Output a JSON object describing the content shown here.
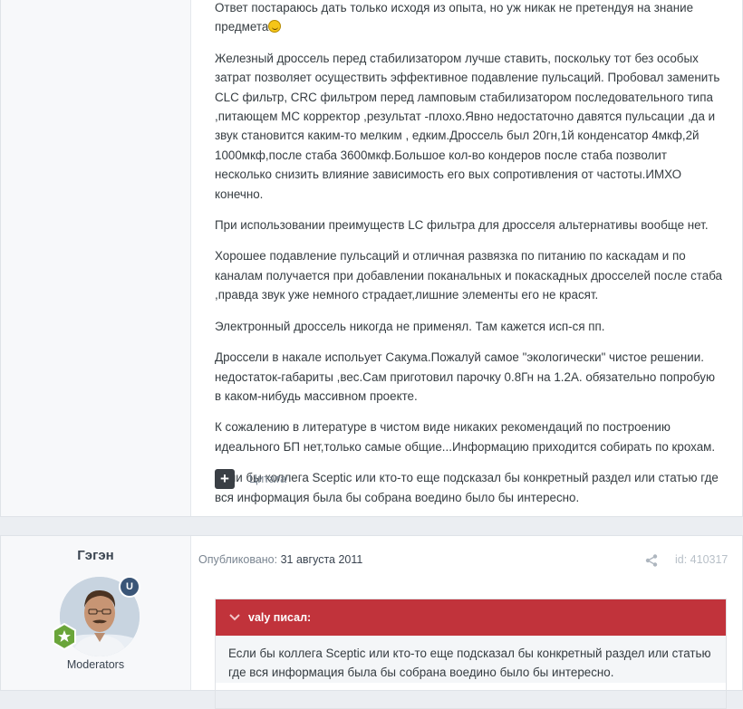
{
  "post1": {
    "paragraphs": [
      "Ответ постараюсь дать только исходя из опыта, но уж никак не претендуя на знание предмета",
      "Железный дроссель перед стабилизатором лучше ставить, поскольку тот без особых затрат позволяет осуществить эффективное подавление пульсаций. Пробовал заменить CLC фильтр, CRC фильтром перед ламповым стабилизатором последовательного типа ,питающем МС корректор ,результат -плохо.Явно недостаточно давятся пульсации ,да и звук становится каким-то мелким , едким.Дроссель был 20гн,1й конденсатор 4мкф,2й 1000мкф,после стаба 3600мкф.Большое кол-во кондеров после стаба позволит несколько снизить влияние зависимость его вых сопротивления от частоты.ИМХО конечно.",
      "При использовании преимуществ LC фильтра для дросселя альтернативы вообще нет.",
      "Хорошее подавление пульсаций и отличная развязка по питанию по каскадам и по каналам получается при добавлении поканальных и покаскадных дросселей после стаба ,правда звук уже немного страдает,лишние элементы его не красят.",
      "Электронный дроссель никогда не применял. Там кажется исп-ся пп.",
      "Дроссели в накале испольует Сакума.Пожалуй самое \"экологически\" чистое решении. недостаток-габариты ,вес.Сам приготовил парочку 0.8Гн на 1.2А. обязательно попробую в каком-нибудь массивном проекте.",
      "К сожалению в литературе в чистом виде никаких рекомендаций по построению идеального БП нет,только самые общие...Информацию приходится собирать по крохам.",
      "Если бы коллега Sceptic или кто-то еще подсказал бы конкретный раздел или статью где вся информация была бы собрана воедино было бы интересно."
    ],
    "quote_button_icon": "+",
    "quote_label": "Цитата"
  },
  "post2": {
    "author": "Гэгэн",
    "moderator_badge": "U",
    "group": "Moderators",
    "published_prefix": "Опубликовано: ",
    "published_date": "31 августа 2011",
    "post_id": "id: 410317",
    "quote": {
      "author_line": "valy писал:",
      "text": "Если бы коллега Sceptic или кто-то еще подсказал бы конкретный раздел или статью где вся информация была бы собрана воедино было бы интересно."
    }
  },
  "icons": {
    "smile": "grinning-smiley-icon",
    "share": "share-icon",
    "rank": "star-badge-icon",
    "chevron": "chevron-down-icon"
  },
  "colors": {
    "quote_header": "#c1333b",
    "rank_badge": "#6aa53a",
    "mod_badge": "#3a5577"
  }
}
